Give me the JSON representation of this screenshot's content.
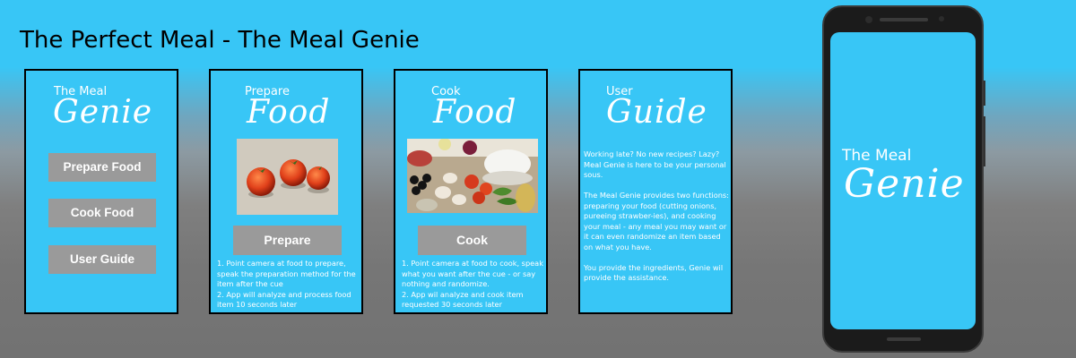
{
  "page_title": "The Perfect Meal - The Meal Genie",
  "home": {
    "small_title": "The Meal",
    "big_title": "Genie",
    "buttons": [
      "Prepare Food",
      "Cook Food",
      "User Guide"
    ]
  },
  "prepare": {
    "small_title": "Prepare",
    "big_title": "Food",
    "button": "Prepare",
    "instructions": "1. Point camera at food to prepare, speak the preparation method for the item after the cue\n2. App will analyze and process food item 10 seconds later"
  },
  "cook": {
    "small_title": "Cook",
    "big_title": "Food",
    "button": "Cook",
    "instructions": "1. Point camera at food to cook, speak what you want after the cue - or say nothing and randomize.\n2. App wil analyze and cook item requested 30 seconds later"
  },
  "guide": {
    "small_title": "User",
    "big_title": "Guide",
    "paragraphs": [
      "Working late? No new recipes? Lazy? Meal Genie is here to be your personal sous.",
      "The Meal Genie provides two functions: preparing your food (cutting onions, pureeing strawber-ies), and cooking your meal - any meal you may want or it can even randomize an item based on what you have.",
      "You provide the ingredients, Genie wil provide the assistance."
    ]
  },
  "phone": {
    "small_title": "The Meal",
    "big_title": "Genie"
  },
  "colors": {
    "screen_blue": "#38c6f6",
    "button_gray": "#9a9a9a"
  }
}
